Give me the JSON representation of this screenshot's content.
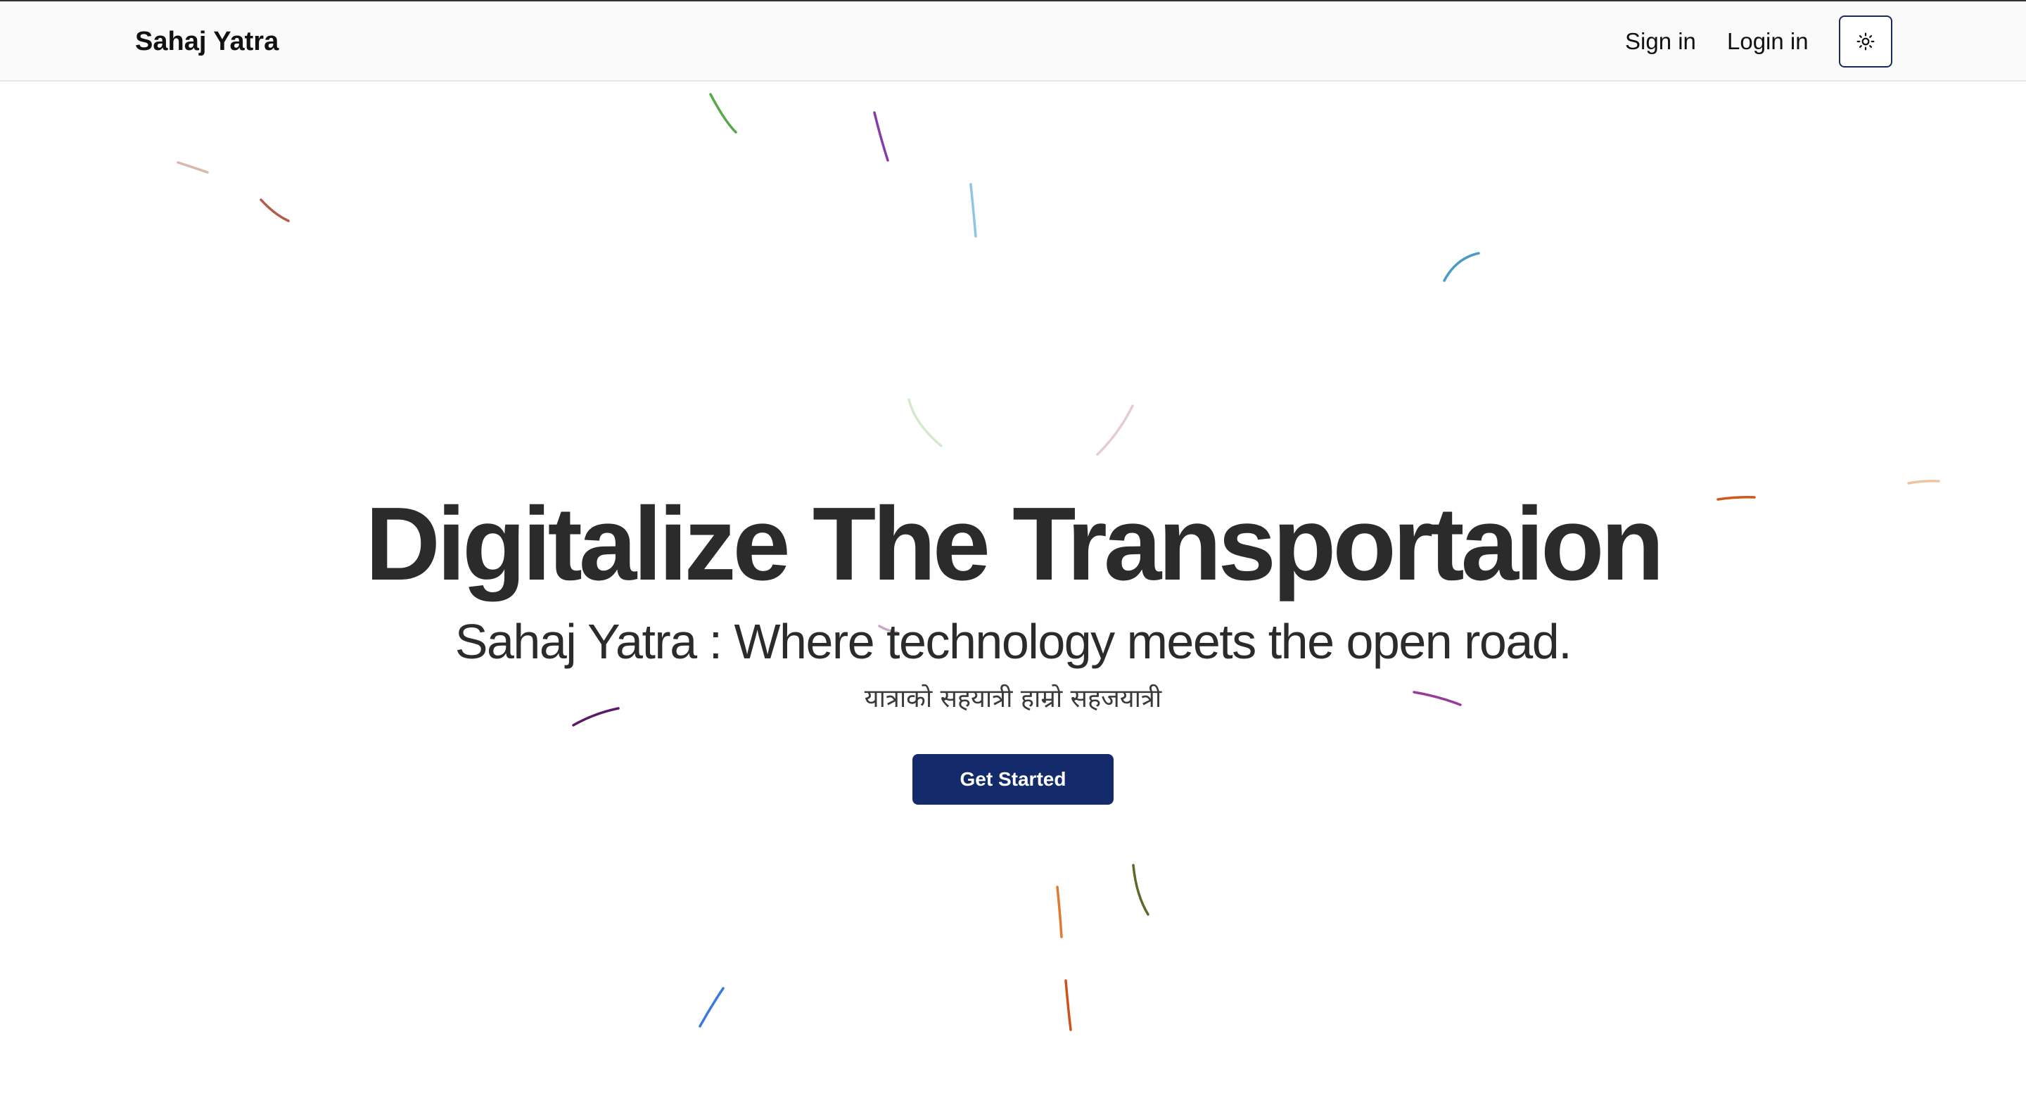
{
  "navbar": {
    "brand": "Sahaj Yatra",
    "links": {
      "sign_in": "Sign in",
      "login_in": "Login in"
    },
    "theme_toggle_icon": "sun-icon"
  },
  "hero": {
    "title": "Digitalize The Transportaion",
    "subtitle": "Sahaj Yatra : Where technology meets the open road.",
    "tagline": "यात्राको सहयात्री हाम्रो सहजयात्री",
    "cta_label": "Get Started"
  },
  "colors": {
    "primary": "#142b6b",
    "text": "#2b2b2b",
    "navbar_bg": "#fafafa"
  }
}
